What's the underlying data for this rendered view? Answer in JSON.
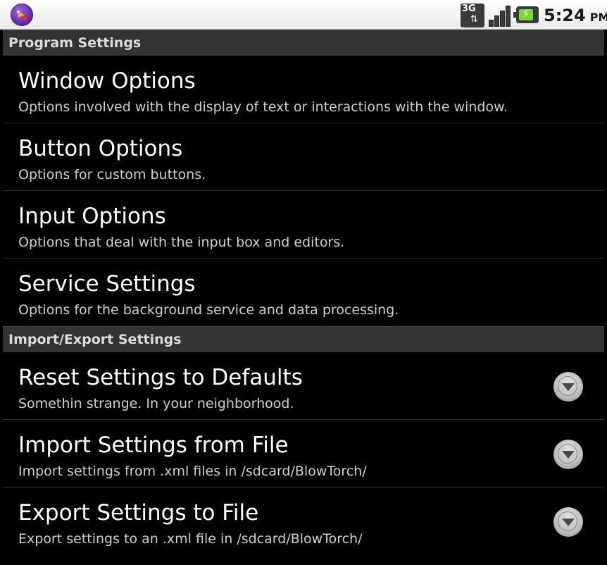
{
  "status_bar": {
    "network_label": "3G",
    "network_arrows": "⇅",
    "battery_bolt": "⚡",
    "time": "5:24",
    "ampm": "PM",
    "icons": [
      "app-icon",
      "3g-icon",
      "signal-icon",
      "battery-charging-icon"
    ]
  },
  "sections": [
    {
      "header": "Program Settings",
      "items": [
        {
          "title": "Window Options",
          "summary": "Options involved with the display of text or interactions with the window."
        },
        {
          "title": "Button Options",
          "summary": "Options for custom buttons."
        },
        {
          "title": "Input Options",
          "summary": "Options that deal with the input box and editors."
        },
        {
          "title": "Service Settings",
          "summary": "Options for the background service and data processing."
        }
      ]
    },
    {
      "header": "Import/Export Settings",
      "items": [
        {
          "title": "Reset Settings to Defaults",
          "summary": "Somethin strange. In your neighborhood.",
          "icon": "dropdown-arrow-icon"
        },
        {
          "title": "Import Settings from File",
          "summary": "Import settings from .xml files in /sdcard/BlowTorch/",
          "icon": "dropdown-arrow-icon"
        },
        {
          "title": "Export Settings to File",
          "summary": "Export settings to an .xml file in /sdcard/BlowTorch/",
          "icon": "dropdown-arrow-icon"
        }
      ]
    }
  ],
  "colors": {
    "background": "#000000",
    "category_bg": "#333333",
    "status_bar_bg": "#ffffff"
  }
}
